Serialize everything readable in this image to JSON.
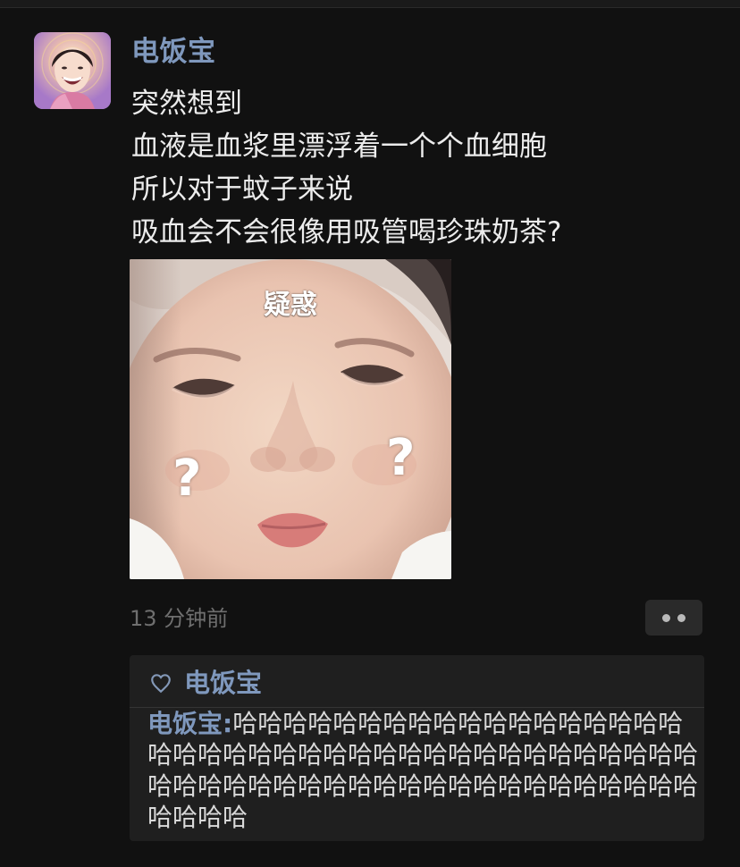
{
  "post": {
    "author": "电饭宝",
    "text": "突然想到\n血液是血浆里漂浮着一个个血细胞\n所以对于蚊子来说\n吸血会不会很像用吸管喝珍珠奶茶?",
    "image": {
      "caption": "疑惑",
      "left_mark": "?",
      "right_mark": "?"
    },
    "time": "13 分钟前"
  },
  "comments_section": {
    "liked_by": "电饭宝",
    "comment": {
      "author": "电饭宝:",
      "text": "哈哈哈哈哈哈哈哈哈哈哈哈哈哈哈哈哈哈哈哈哈哈哈哈哈哈哈哈哈哈哈哈哈哈哈哈哈哈哈哈哈哈哈哈哈哈哈哈哈哈哈哈哈哈哈哈哈哈哈哈哈哈哈哈哈哈"
    }
  },
  "colors": {
    "background": "#111111",
    "author_blue": "#7f98bd",
    "text": "#ececec",
    "muted": "#6f6f6f",
    "comment_panel": "#1f1f1f"
  },
  "icons": {
    "like": "heart-icon",
    "more": "more-dots-icon"
  }
}
